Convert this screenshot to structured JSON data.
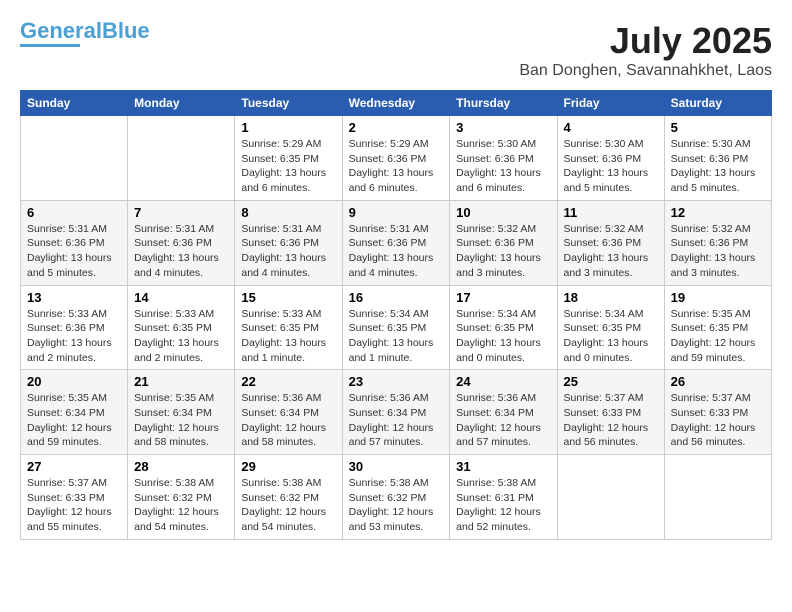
{
  "header": {
    "logo_line1": "General",
    "logo_line2": "Blue",
    "month_year": "July 2025",
    "location": "Ban Donghen, Savannahkhet, Laos"
  },
  "days_of_week": [
    "Sunday",
    "Monday",
    "Tuesday",
    "Wednesday",
    "Thursday",
    "Friday",
    "Saturday"
  ],
  "weeks": [
    [
      {
        "day": "",
        "info": ""
      },
      {
        "day": "",
        "info": ""
      },
      {
        "day": "1",
        "info": "Sunrise: 5:29 AM\nSunset: 6:35 PM\nDaylight: 13 hours and 6 minutes."
      },
      {
        "day": "2",
        "info": "Sunrise: 5:29 AM\nSunset: 6:36 PM\nDaylight: 13 hours and 6 minutes."
      },
      {
        "day": "3",
        "info": "Sunrise: 5:30 AM\nSunset: 6:36 PM\nDaylight: 13 hours and 6 minutes."
      },
      {
        "day": "4",
        "info": "Sunrise: 5:30 AM\nSunset: 6:36 PM\nDaylight: 13 hours and 5 minutes."
      },
      {
        "day": "5",
        "info": "Sunrise: 5:30 AM\nSunset: 6:36 PM\nDaylight: 13 hours and 5 minutes."
      }
    ],
    [
      {
        "day": "6",
        "info": "Sunrise: 5:31 AM\nSunset: 6:36 PM\nDaylight: 13 hours and 5 minutes."
      },
      {
        "day": "7",
        "info": "Sunrise: 5:31 AM\nSunset: 6:36 PM\nDaylight: 13 hours and 4 minutes."
      },
      {
        "day": "8",
        "info": "Sunrise: 5:31 AM\nSunset: 6:36 PM\nDaylight: 13 hours and 4 minutes."
      },
      {
        "day": "9",
        "info": "Sunrise: 5:31 AM\nSunset: 6:36 PM\nDaylight: 13 hours and 4 minutes."
      },
      {
        "day": "10",
        "info": "Sunrise: 5:32 AM\nSunset: 6:36 PM\nDaylight: 13 hours and 3 minutes."
      },
      {
        "day": "11",
        "info": "Sunrise: 5:32 AM\nSunset: 6:36 PM\nDaylight: 13 hours and 3 minutes."
      },
      {
        "day": "12",
        "info": "Sunrise: 5:32 AM\nSunset: 6:36 PM\nDaylight: 13 hours and 3 minutes."
      }
    ],
    [
      {
        "day": "13",
        "info": "Sunrise: 5:33 AM\nSunset: 6:36 PM\nDaylight: 13 hours and 2 minutes."
      },
      {
        "day": "14",
        "info": "Sunrise: 5:33 AM\nSunset: 6:35 PM\nDaylight: 13 hours and 2 minutes."
      },
      {
        "day": "15",
        "info": "Sunrise: 5:33 AM\nSunset: 6:35 PM\nDaylight: 13 hours and 1 minute."
      },
      {
        "day": "16",
        "info": "Sunrise: 5:34 AM\nSunset: 6:35 PM\nDaylight: 13 hours and 1 minute."
      },
      {
        "day": "17",
        "info": "Sunrise: 5:34 AM\nSunset: 6:35 PM\nDaylight: 13 hours and 0 minutes."
      },
      {
        "day": "18",
        "info": "Sunrise: 5:34 AM\nSunset: 6:35 PM\nDaylight: 13 hours and 0 minutes."
      },
      {
        "day": "19",
        "info": "Sunrise: 5:35 AM\nSunset: 6:35 PM\nDaylight: 12 hours and 59 minutes."
      }
    ],
    [
      {
        "day": "20",
        "info": "Sunrise: 5:35 AM\nSunset: 6:34 PM\nDaylight: 12 hours and 59 minutes."
      },
      {
        "day": "21",
        "info": "Sunrise: 5:35 AM\nSunset: 6:34 PM\nDaylight: 12 hours and 58 minutes."
      },
      {
        "day": "22",
        "info": "Sunrise: 5:36 AM\nSunset: 6:34 PM\nDaylight: 12 hours and 58 minutes."
      },
      {
        "day": "23",
        "info": "Sunrise: 5:36 AM\nSunset: 6:34 PM\nDaylight: 12 hours and 57 minutes."
      },
      {
        "day": "24",
        "info": "Sunrise: 5:36 AM\nSunset: 6:34 PM\nDaylight: 12 hours and 57 minutes."
      },
      {
        "day": "25",
        "info": "Sunrise: 5:37 AM\nSunset: 6:33 PM\nDaylight: 12 hours and 56 minutes."
      },
      {
        "day": "26",
        "info": "Sunrise: 5:37 AM\nSunset: 6:33 PM\nDaylight: 12 hours and 56 minutes."
      }
    ],
    [
      {
        "day": "27",
        "info": "Sunrise: 5:37 AM\nSunset: 6:33 PM\nDaylight: 12 hours and 55 minutes."
      },
      {
        "day": "28",
        "info": "Sunrise: 5:38 AM\nSunset: 6:32 PM\nDaylight: 12 hours and 54 minutes."
      },
      {
        "day": "29",
        "info": "Sunrise: 5:38 AM\nSunset: 6:32 PM\nDaylight: 12 hours and 54 minutes."
      },
      {
        "day": "30",
        "info": "Sunrise: 5:38 AM\nSunset: 6:32 PM\nDaylight: 12 hours and 53 minutes."
      },
      {
        "day": "31",
        "info": "Sunrise: 5:38 AM\nSunset: 6:31 PM\nDaylight: 12 hours and 52 minutes."
      },
      {
        "day": "",
        "info": ""
      },
      {
        "day": "",
        "info": ""
      }
    ]
  ]
}
